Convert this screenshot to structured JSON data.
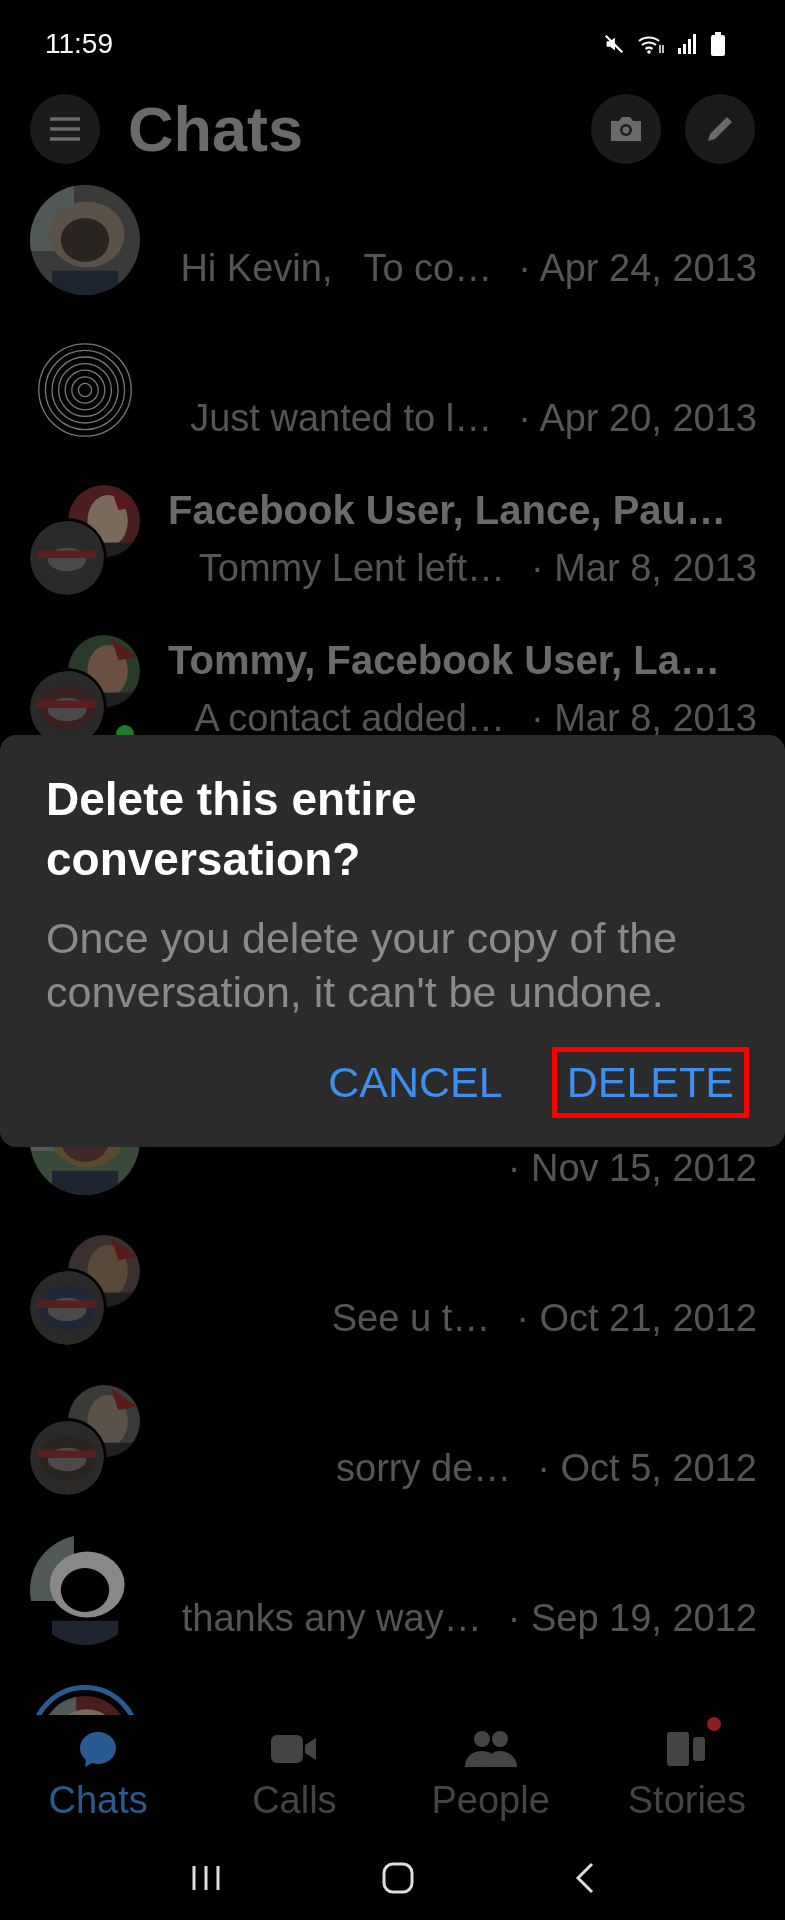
{
  "status_bar": {
    "time": "11:59"
  },
  "header": {
    "title": "Chats"
  },
  "chats": [
    {
      "kind": "single",
      "preview": "Hi Kevin,   To co…",
      "date": "· Apr 24, 2013",
      "online": false,
      "story_ring": false
    },
    {
      "kind": "single",
      "preview": "Just wanted to l…",
      "date": "· Apr 20, 2013",
      "online": false,
      "story_ring": false
    },
    {
      "kind": "group",
      "name": "Facebook User, Lance, Pau…",
      "preview": "Tommy Lent left…",
      "date": "· Mar 8, 2013",
      "online": false,
      "story_ring": false
    },
    {
      "kind": "group",
      "name": "Tommy, Facebook User, La…",
      "preview": "A contact added…",
      "date": "· Mar 8, 2013",
      "online": true,
      "story_ring": false
    }
  ],
  "dialog": {
    "title": "Delete this entire conversation?",
    "message": "Once you delete your copy of the conversation, it can't be undone.",
    "buttons": [
      {
        "label": "CANCEL",
        "highlighted": false
      },
      {
        "label": "DELETE",
        "highlighted": true
      }
    ]
  },
  "chats_below": [
    {
      "kind": "single",
      "date": "· Nov 15, 2012",
      "online": false,
      "story_ring": false
    },
    {
      "kind": "group",
      "preview": "See u t…",
      "date": "· Oct 21, 2012",
      "online": false,
      "story_ring": false
    },
    {
      "kind": "group",
      "preview": "sorry de…",
      "date": "· Oct 5, 2012",
      "online": false,
      "story_ring": false
    },
    {
      "kind": "single",
      "preview": "thanks any way…",
      "date": "· Sep 19, 2012",
      "online": false,
      "story_ring": false
    },
    {
      "kind": "single",
      "online": false,
      "story_ring": true
    }
  ],
  "tabs": [
    {
      "label": "Chats",
      "selected": true,
      "badge": false
    },
    {
      "label": "Calls",
      "selected": false,
      "badge": false
    },
    {
      "label": "People",
      "selected": false,
      "badge": false
    },
    {
      "label": "Stories",
      "selected": false,
      "badge": true
    }
  ]
}
